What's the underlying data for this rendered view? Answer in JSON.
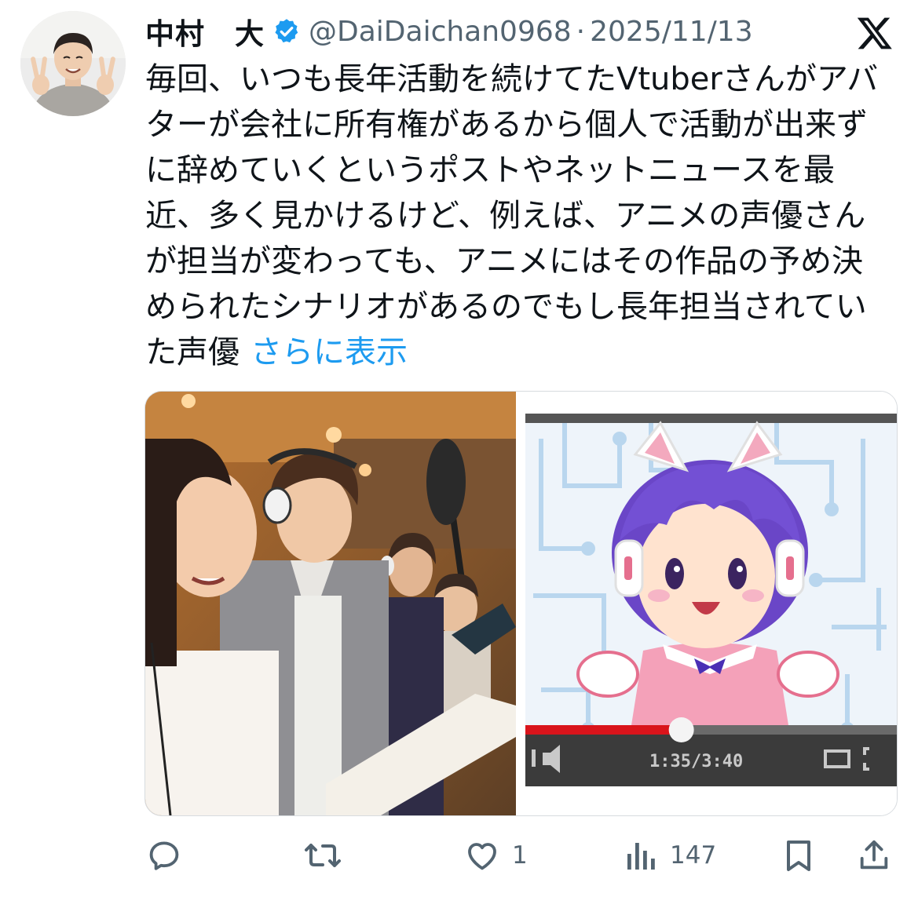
{
  "author": {
    "display_name": "中村　大",
    "handle": "@DaiDaichan0968",
    "separator": "·",
    "date": "2025/11/13",
    "verified": true,
    "avatar_icon": "avatar-photo"
  },
  "tweet": {
    "text": "毎回、いつも長年活動を続けてたVtuberさんがアバターが会社に所有権があるから個人で活動が出来ずに辞めていくというポストやネットニュースを最近、多く見かけるけど、例えば、アニメの声優さんが担当が変わっても、アニメにはその作品の予め決められたシナリオがあるのでもし長年担当されていた声優",
    "show_more": "さらに表示"
  },
  "media": {
    "images": [
      {
        "icon": "voice-actors-recording-photo"
      },
      {
        "icon": "vtuber-illustration"
      }
    ],
    "player_time": "1:35/3:40",
    "progress": 0.42
  },
  "actions": {
    "reply": {
      "icon": "reply-icon",
      "count": ""
    },
    "retweet": {
      "icon": "retweet-icon",
      "count": ""
    },
    "like": {
      "icon": "heart-icon",
      "count": "1"
    },
    "views": {
      "icon": "views-icon",
      "count": "147"
    },
    "bookmark": {
      "icon": "bookmark-icon"
    },
    "share": {
      "icon": "share-icon"
    }
  },
  "colors": {
    "link": "#1d9bf0",
    "verified": "#1d9bf0",
    "secondary_text": "#536471",
    "text": "#0f1419"
  }
}
